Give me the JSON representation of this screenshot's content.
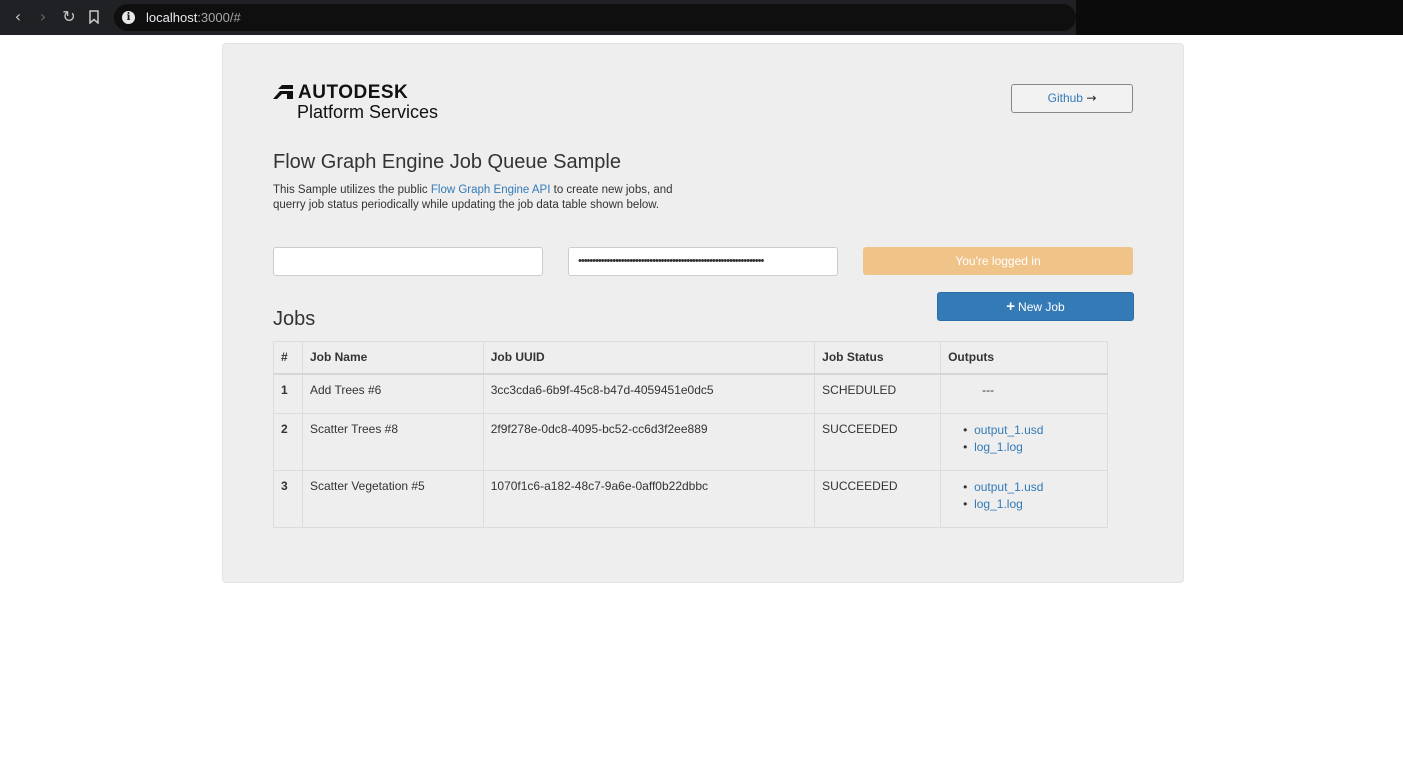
{
  "browser": {
    "url_host": "localhost",
    "url_rest": ":3000/#",
    "back_icon": "chevron-left-icon",
    "forward_icon": "chevron-right-icon",
    "reload_icon": "reload-icon",
    "bookmark_icon": "bookmark-icon"
  },
  "header": {
    "logo_line1": "AUTODESK",
    "logo_line2": "Platform Services",
    "github_label": "Github"
  },
  "intro": {
    "title": "Flow Graph Engine Job Queue Sample",
    "desc_before": "This Sample utilizes the public ",
    "desc_link": "Flow Graph Engine API",
    "desc_after": " to create new jobs, and querry job status periodically while updating the job data table shown below."
  },
  "auth": {
    "client_id_value": "",
    "client_secret_value": "•••••••••••••••••••••••••••••••••••••••••••••••••••••••••••••••••",
    "login_label": "You're logged in"
  },
  "jobs": {
    "heading": "Jobs",
    "new_job_label": "New Job",
    "columns": [
      "#",
      "Job Name",
      "Job UUID",
      "Job Status",
      "Outputs"
    ],
    "rows": [
      {
        "num": "1",
        "name": "Add Trees #6",
        "uuid": "3cc3cda6-6b9f-45c8-b47d-4059451e0dc5",
        "status": "SCHEDULED",
        "empty_output": "---"
      },
      {
        "num": "2",
        "name": "Scatter Trees #8",
        "uuid": "2f9f278e-0dc8-4095-bc52-cc6d3f2ee889",
        "status": "SUCCEEDED",
        "outputs": [
          "output_1.usd",
          "log_1.log"
        ]
      },
      {
        "num": "3",
        "name": "Scatter Vegetation #5",
        "uuid": "1070f1c6-a182-48c7-9a6e-0aff0b22dbbc",
        "status": "SUCCEEDED",
        "outputs": [
          "output_1.usd",
          "log_1.log"
        ]
      }
    ]
  },
  "colors": {
    "accent": "#337ab7",
    "login_bg": "#f0c389",
    "panel_bg": "#eeeeee"
  }
}
